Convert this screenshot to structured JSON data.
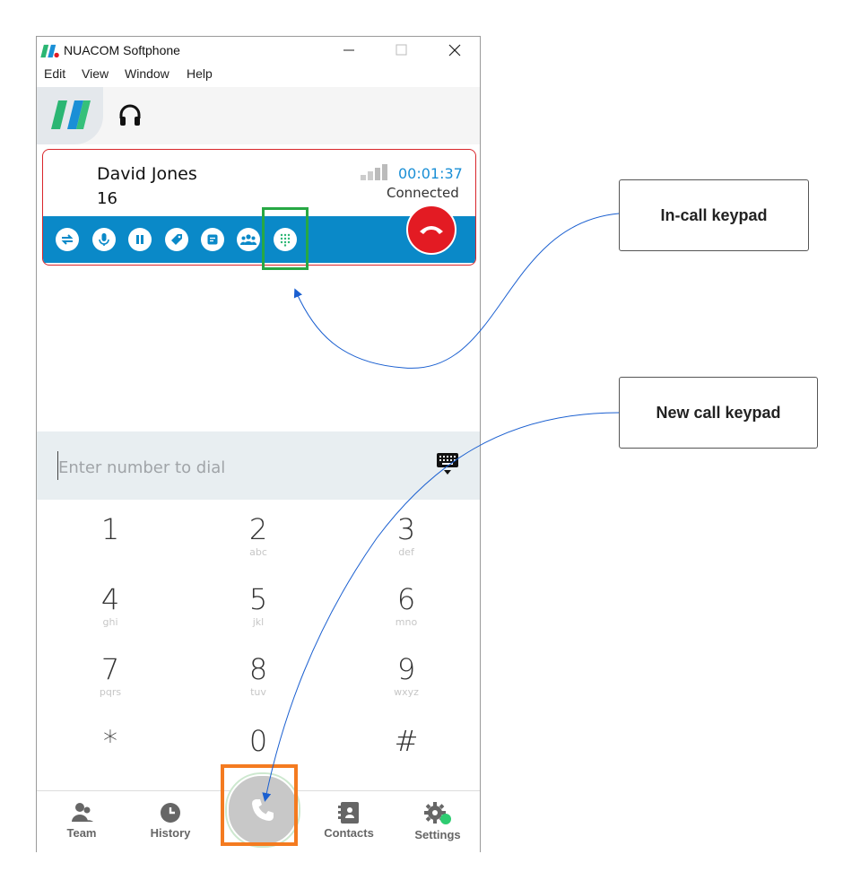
{
  "window": {
    "title": "NUACOM Softphone"
  },
  "menu": [
    "Edit",
    "View",
    "Window",
    "Help"
  ],
  "call": {
    "name": "David Jones",
    "number": "16",
    "duration": "00:01:37",
    "status": "Connected"
  },
  "call_controls": [
    {
      "icon": "transfer-icon"
    },
    {
      "icon": "microphone-icon"
    },
    {
      "icon": "pause-icon"
    },
    {
      "icon": "tag-icon"
    },
    {
      "icon": "note-icon"
    },
    {
      "icon": "conference-icon"
    },
    {
      "icon": "keypad-icon"
    }
  ],
  "dial": {
    "placeholder": "Enter number to dial"
  },
  "keys": [
    {
      "digit": "1",
      "letters": ""
    },
    {
      "digit": "2",
      "letters": "abc"
    },
    {
      "digit": "3",
      "letters": "def"
    },
    {
      "digit": "4",
      "letters": "ghi"
    },
    {
      "digit": "5",
      "letters": "jkl"
    },
    {
      "digit": "6",
      "letters": "mno"
    },
    {
      "digit": "7",
      "letters": "pqrs"
    },
    {
      "digit": "8",
      "letters": "tuv"
    },
    {
      "digit": "9",
      "letters": "wxyz"
    },
    {
      "digit": "*",
      "letters": ""
    },
    {
      "digit": "0",
      "letters": ""
    },
    {
      "digit": "#",
      "letters": ""
    }
  ],
  "nav": {
    "team": "Team",
    "history": "History",
    "contacts": "Contacts",
    "settings": "Settings"
  },
  "annotations": {
    "incall": "In-call keypad",
    "newcall": "New call keypad"
  },
  "colors": {
    "accent": "#0a89c8",
    "hangup": "#e31b23",
    "timer": "#1a8fd6",
    "highlight_incall": "#27a844",
    "highlight_newcall": "#f47b20",
    "presence": "#2ecc71"
  }
}
